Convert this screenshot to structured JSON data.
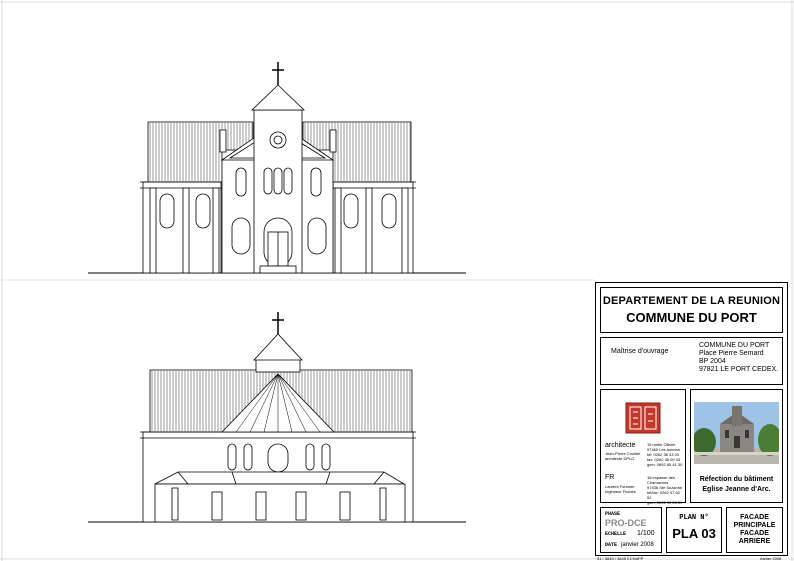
{
  "title_block": {
    "department": "DEPARTEMENT DE LA REUNION",
    "commune": "COMMUNE DU PORT",
    "maitrise_label": "Maîtrise d'ouvrage",
    "client_lines": [
      "COMMUNE DU PORT",
      "Place Pierre Semard",
      "BP 2004",
      "97821 LE PORT CEDEX."
    ],
    "architecte_label": "architecte",
    "architecte_lines": [
      "Jean-Pierre Couilier",
      "architecte DPLG"
    ],
    "architecte_addr": [
      "15 ruelle Ollivier",
      "97460 Les Avirons",
      "tel: 0262 38 43 03",
      "fax: 0262 38 09 03",
      "gsm: 0692 85 41 30"
    ],
    "ingenieur_label": "FR",
    "ingenieur_lines": [
      "Laurent Fournier",
      "Ingénieur Fluides"
    ],
    "ingenieur_addr": [
      "18 impasse des Chamachés",
      "97436 Ste Suzanne",
      "tel/fax: 0262 97 62 52",
      "gsm: 0692 39 03 59"
    ],
    "project_line1": "Réfection du bâtiment",
    "project_line2": "Eglise Jeanne d'Arc.",
    "phase_label": "PHASE",
    "phase_value": "PRO-DCE",
    "echelle_label": "ECHELLE",
    "echelle_value": "1/100",
    "date_label": "DATE",
    "date_value": "janvier 2008",
    "plan_label": "PLAN N°",
    "plan_value": "PLA 03",
    "sheet_title": [
      "FACADE",
      "PRINCIPALE",
      "FACADE",
      "ARRIERE"
    ]
  },
  "footer_left": "01 / 3845 / 3845 ECHAPP",
  "footer_right": "Atelier 2008"
}
